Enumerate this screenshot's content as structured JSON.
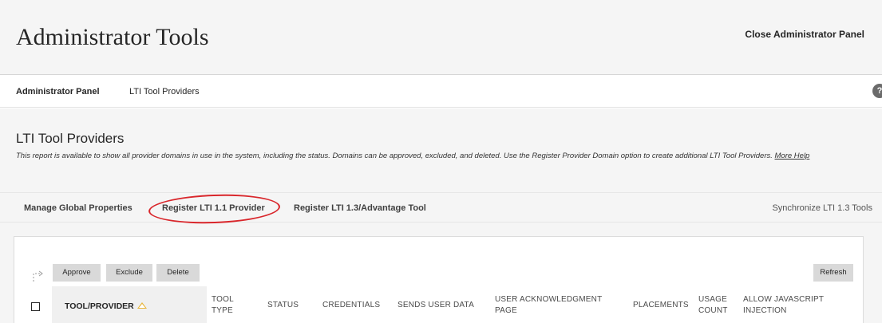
{
  "header": {
    "title": "Administrator Tools",
    "close_label": "Close Administrator Panel"
  },
  "breadcrumb": {
    "items": [
      "Administrator Panel",
      "LTI Tool Providers"
    ],
    "help_icon": "?"
  },
  "section": {
    "title": "LTI Tool Providers",
    "description": "This report is available to show all provider domains in use in the system, including the status. Domains can be approved, excluded, and deleted. Use the Register Provider Domain option to create additional LTI Tool Providers.",
    "more_help": "More Help"
  },
  "action_bar": {
    "items": [
      "Manage Global Properties",
      "Register LTI 1.1 Provider",
      "Register LTI 1.3/Advantage Tool"
    ],
    "right_item": "Synchronize LTI 1.3 Tools",
    "annotation_color": "#d9262b"
  },
  "table": {
    "buttons": [
      "Approve",
      "Exclude",
      "Delete"
    ],
    "refresh": "Refresh",
    "sorted_column": "TOOL/PROVIDER",
    "columns": [
      "TOOL TYPE",
      "STATUS",
      "CREDENTIALS",
      "SENDS USER DATA",
      "USER ACKNOWLEDGMENT PAGE",
      "PLACEMENTS",
      "USAGE COUNT",
      "ALLOW JAVASCRIPT INJECTION"
    ]
  }
}
